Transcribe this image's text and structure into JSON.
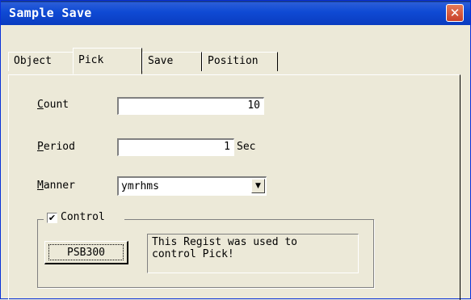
{
  "window": {
    "title": "Sample Save",
    "close_glyph": "✕"
  },
  "tabs": [
    {
      "label": "Object",
      "active": false
    },
    {
      "label": "Pick",
      "active": true
    },
    {
      "label": "Save",
      "active": false
    },
    {
      "label": "Position",
      "active": false
    }
  ],
  "form": {
    "count": {
      "label_first": "C",
      "label_rest": "ount",
      "value": "10"
    },
    "period": {
      "label_first": "P",
      "label_rest": "eriod",
      "value": "1",
      "unit": "Sec"
    },
    "manner": {
      "label_first": "M",
      "label_rest": "anner",
      "value": "ymrhms",
      "arrow": "▼"
    }
  },
  "control": {
    "group_label": "Control",
    "checked": true,
    "check_glyph": "✔",
    "button_label": "PSB300",
    "info_text": "This Regist was used to\ncontrol Pick!"
  },
  "icons": {
    "close": "close-icon",
    "dropdown": "chevron-down-icon",
    "check": "checkmark-icon"
  }
}
